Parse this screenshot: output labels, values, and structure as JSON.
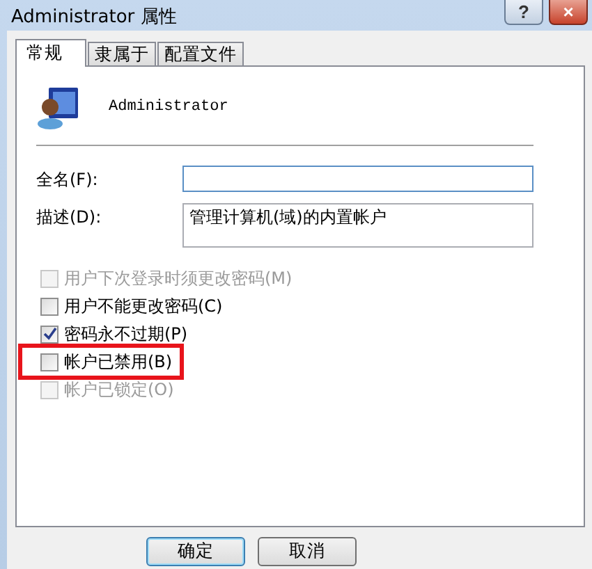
{
  "window": {
    "title": "Administrator 属性",
    "buttons": [
      {
        "kind": "help",
        "label": "?"
      },
      {
        "kind": "close",
        "label": "×"
      }
    ]
  },
  "tabs": [
    {
      "label": "常规",
      "selected": true
    },
    {
      "label": "隶属于",
      "selected": false
    },
    {
      "label": "配置文件",
      "selected": false
    }
  ],
  "user": {
    "name": "Administrator"
  },
  "fields": [
    {
      "label": "全名(F):",
      "kind": "line",
      "focused": true
    },
    {
      "label": "描述(D):",
      "value": "管理计算机(域)的内置帐户",
      "kind": "box",
      "focused": false
    }
  ],
  "checkboxes": [
    {
      "label": "用户下次登录时须更改密码(M)",
      "checked": false,
      "disabled": true,
      "highlighted": false
    },
    {
      "label": "用户不能更改密码(C)",
      "checked": false,
      "disabled": false,
      "highlighted": false
    },
    {
      "label": "密码永不过期(P)",
      "checked": true,
      "disabled": false,
      "highlighted": false
    },
    {
      "label": "帐户已禁用(B)",
      "checked": false,
      "disabled": false,
      "highlighted": true
    },
    {
      "label": "帐户已锁定(O)",
      "checked": false,
      "disabled": true,
      "highlighted": false
    }
  ],
  "buttons": [
    {
      "label": "确定",
      "default": true
    },
    {
      "label": "取消",
      "default": false
    }
  ]
}
